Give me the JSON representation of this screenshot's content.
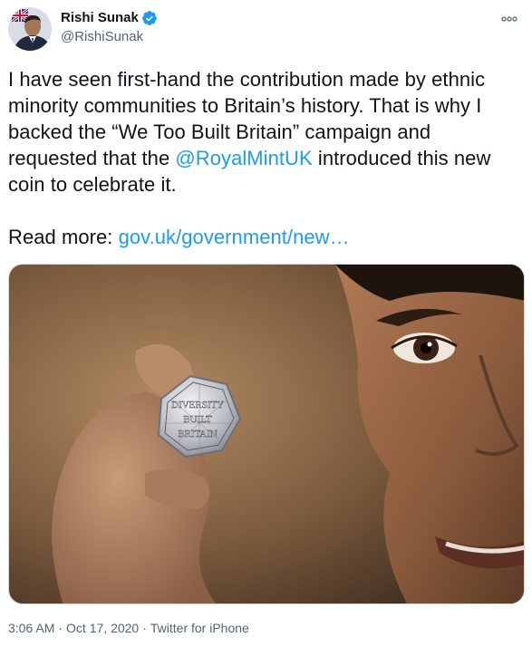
{
  "author": {
    "display_name": "Rishi Sunak",
    "handle": "@RishiSunak",
    "verified": true
  },
  "tweet": {
    "line1_pre": "I have seen first-hand the contribution made by ethnic",
    "line2": "minority communities to Britain’s history. That is why I",
    "line3": "backed the “We Too Built Britain” campaign and",
    "line4_pre": "requested that the ",
    "mention": "@RoyalMintUK",
    "line4_post": " introduced this new",
    "line5": "coin to celebrate it.",
    "read_more_label": "Read more: ",
    "link_text": "gov.uk/government/new…"
  },
  "media": {
    "coin_text": [
      "DIVERSITY",
      "BUILT",
      "BRITAIN"
    ]
  },
  "meta": {
    "time": "3:06 AM",
    "separator": "·",
    "date": "Oct 17, 2020",
    "source": "Twitter for iPhone"
  },
  "colors": {
    "link": "#1d9bf0",
    "secondary_text": "#536471",
    "verified_badge": "#1d9bf0"
  }
}
